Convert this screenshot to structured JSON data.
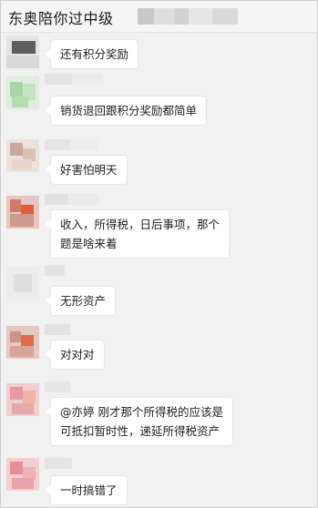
{
  "chat": {
    "title": "东奥陪你过中级",
    "messages": [
      {
        "text": "还有积分奖励"
      },
      {
        "text": "销货退回跟积分奖励都简单"
      },
      {
        "text": "好害怕明天"
      },
      {
        "text": "收入，所得税，日后事项，那个\n题是啥来着"
      },
      {
        "text": "无形资产"
      },
      {
        "text": "对对对"
      },
      {
        "text": "@亦婷 刚才那个所得税的应该是\n可抵扣暂时性，递延所得税资产"
      },
      {
        "text": "一时搞错了"
      }
    ]
  },
  "colors": {
    "background": "#f1f1f1",
    "bubble": "#ffffff",
    "text": "#1f1f1f"
  }
}
